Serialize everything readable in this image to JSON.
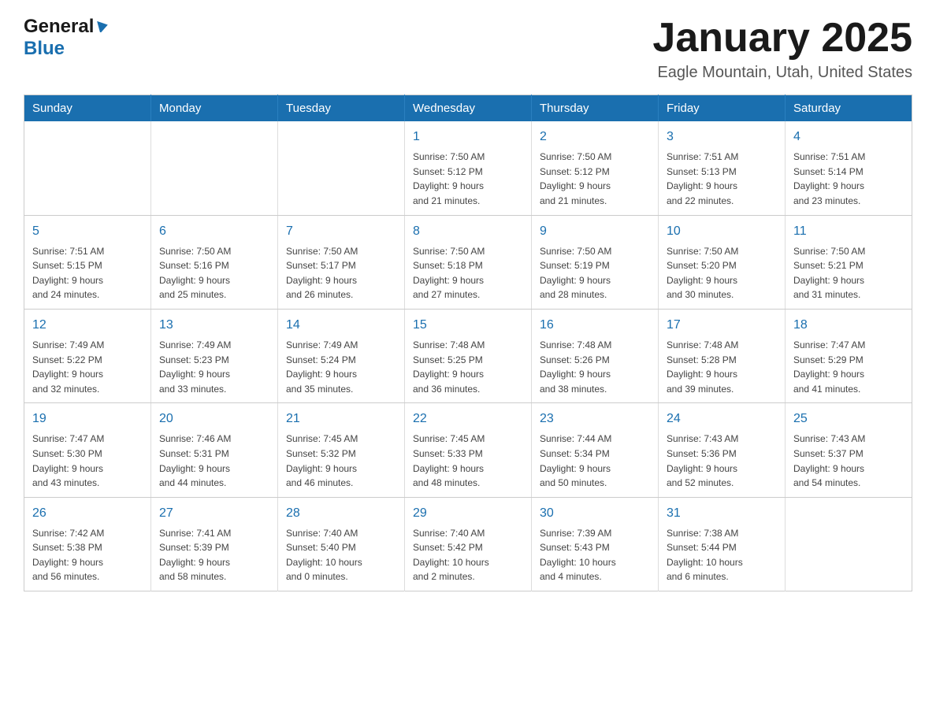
{
  "header": {
    "logo_general": "General",
    "logo_blue": "Blue",
    "month_title": "January 2025",
    "location": "Eagle Mountain, Utah, United States"
  },
  "calendar": {
    "days_of_week": [
      "Sunday",
      "Monday",
      "Tuesday",
      "Wednesday",
      "Thursday",
      "Friday",
      "Saturday"
    ],
    "weeks": [
      [
        {
          "day": "",
          "info": ""
        },
        {
          "day": "",
          "info": ""
        },
        {
          "day": "",
          "info": ""
        },
        {
          "day": "1",
          "info": "Sunrise: 7:50 AM\nSunset: 5:12 PM\nDaylight: 9 hours\nand 21 minutes."
        },
        {
          "day": "2",
          "info": "Sunrise: 7:50 AM\nSunset: 5:12 PM\nDaylight: 9 hours\nand 21 minutes."
        },
        {
          "day": "3",
          "info": "Sunrise: 7:51 AM\nSunset: 5:13 PM\nDaylight: 9 hours\nand 22 minutes."
        },
        {
          "day": "4",
          "info": "Sunrise: 7:51 AM\nSunset: 5:14 PM\nDaylight: 9 hours\nand 23 minutes."
        }
      ],
      [
        {
          "day": "5",
          "info": "Sunrise: 7:51 AM\nSunset: 5:15 PM\nDaylight: 9 hours\nand 24 minutes."
        },
        {
          "day": "6",
          "info": "Sunrise: 7:50 AM\nSunset: 5:16 PM\nDaylight: 9 hours\nand 25 minutes."
        },
        {
          "day": "7",
          "info": "Sunrise: 7:50 AM\nSunset: 5:17 PM\nDaylight: 9 hours\nand 26 minutes."
        },
        {
          "day": "8",
          "info": "Sunrise: 7:50 AM\nSunset: 5:18 PM\nDaylight: 9 hours\nand 27 minutes."
        },
        {
          "day": "9",
          "info": "Sunrise: 7:50 AM\nSunset: 5:19 PM\nDaylight: 9 hours\nand 28 minutes."
        },
        {
          "day": "10",
          "info": "Sunrise: 7:50 AM\nSunset: 5:20 PM\nDaylight: 9 hours\nand 30 minutes."
        },
        {
          "day": "11",
          "info": "Sunrise: 7:50 AM\nSunset: 5:21 PM\nDaylight: 9 hours\nand 31 minutes."
        }
      ],
      [
        {
          "day": "12",
          "info": "Sunrise: 7:49 AM\nSunset: 5:22 PM\nDaylight: 9 hours\nand 32 minutes."
        },
        {
          "day": "13",
          "info": "Sunrise: 7:49 AM\nSunset: 5:23 PM\nDaylight: 9 hours\nand 33 minutes."
        },
        {
          "day": "14",
          "info": "Sunrise: 7:49 AM\nSunset: 5:24 PM\nDaylight: 9 hours\nand 35 minutes."
        },
        {
          "day": "15",
          "info": "Sunrise: 7:48 AM\nSunset: 5:25 PM\nDaylight: 9 hours\nand 36 minutes."
        },
        {
          "day": "16",
          "info": "Sunrise: 7:48 AM\nSunset: 5:26 PM\nDaylight: 9 hours\nand 38 minutes."
        },
        {
          "day": "17",
          "info": "Sunrise: 7:48 AM\nSunset: 5:28 PM\nDaylight: 9 hours\nand 39 minutes."
        },
        {
          "day": "18",
          "info": "Sunrise: 7:47 AM\nSunset: 5:29 PM\nDaylight: 9 hours\nand 41 minutes."
        }
      ],
      [
        {
          "day": "19",
          "info": "Sunrise: 7:47 AM\nSunset: 5:30 PM\nDaylight: 9 hours\nand 43 minutes."
        },
        {
          "day": "20",
          "info": "Sunrise: 7:46 AM\nSunset: 5:31 PM\nDaylight: 9 hours\nand 44 minutes."
        },
        {
          "day": "21",
          "info": "Sunrise: 7:45 AM\nSunset: 5:32 PM\nDaylight: 9 hours\nand 46 minutes."
        },
        {
          "day": "22",
          "info": "Sunrise: 7:45 AM\nSunset: 5:33 PM\nDaylight: 9 hours\nand 48 minutes."
        },
        {
          "day": "23",
          "info": "Sunrise: 7:44 AM\nSunset: 5:34 PM\nDaylight: 9 hours\nand 50 minutes."
        },
        {
          "day": "24",
          "info": "Sunrise: 7:43 AM\nSunset: 5:36 PM\nDaylight: 9 hours\nand 52 minutes."
        },
        {
          "day": "25",
          "info": "Sunrise: 7:43 AM\nSunset: 5:37 PM\nDaylight: 9 hours\nand 54 minutes."
        }
      ],
      [
        {
          "day": "26",
          "info": "Sunrise: 7:42 AM\nSunset: 5:38 PM\nDaylight: 9 hours\nand 56 minutes."
        },
        {
          "day": "27",
          "info": "Sunrise: 7:41 AM\nSunset: 5:39 PM\nDaylight: 9 hours\nand 58 minutes."
        },
        {
          "day": "28",
          "info": "Sunrise: 7:40 AM\nSunset: 5:40 PM\nDaylight: 10 hours\nand 0 minutes."
        },
        {
          "day": "29",
          "info": "Sunrise: 7:40 AM\nSunset: 5:42 PM\nDaylight: 10 hours\nand 2 minutes."
        },
        {
          "day": "30",
          "info": "Sunrise: 7:39 AM\nSunset: 5:43 PM\nDaylight: 10 hours\nand 4 minutes."
        },
        {
          "day": "31",
          "info": "Sunrise: 7:38 AM\nSunset: 5:44 PM\nDaylight: 10 hours\nand 6 minutes."
        },
        {
          "day": "",
          "info": ""
        }
      ]
    ]
  }
}
